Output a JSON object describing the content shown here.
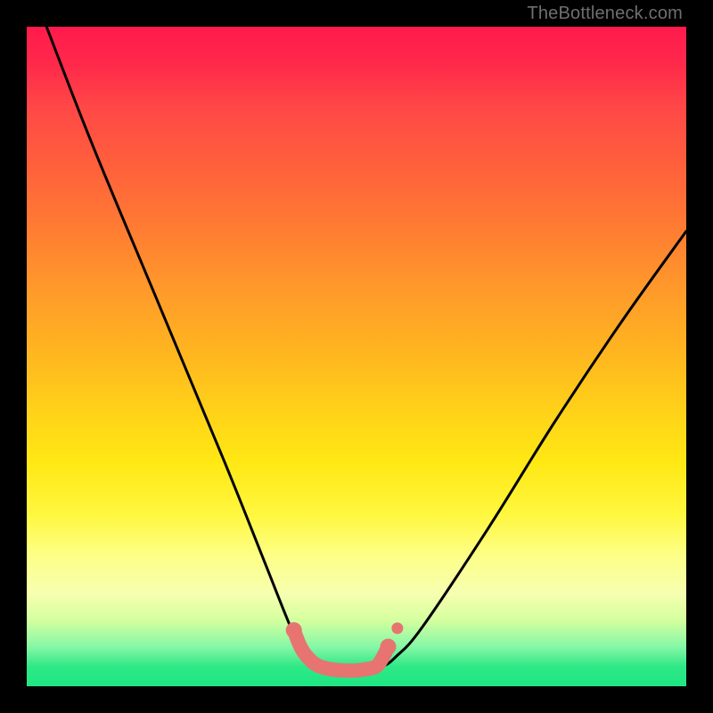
{
  "watermark": "TheBottleneck.com",
  "chart_data": {
    "type": "line",
    "title": "",
    "xlabel": "",
    "ylabel": "",
    "xlim": [
      0,
      100
    ],
    "ylim": [
      0,
      100
    ],
    "series": [
      {
        "name": "curve",
        "x": [
          3,
          10,
          20,
          30,
          36,
          40,
          42,
          44,
          46,
          48,
          50,
          52,
          54,
          56,
          60,
          70,
          80,
          90,
          100
        ],
        "values": [
          100,
          82,
          58,
          34,
          19,
          9,
          5,
          3,
          2.5,
          2.3,
          2.3,
          2.5,
          3,
          4.5,
          9,
          24,
          40,
          55,
          69
        ]
      },
      {
        "name": "highlight",
        "x": [
          40.5,
          41.5,
          42.5,
          44,
          46,
          48,
          50,
          51.5,
          53,
          54,
          54.8
        ],
        "values": [
          8.5,
          6.0,
          4.5,
          3.2,
          2.6,
          2.4,
          2.4,
          2.6,
          3.0,
          4.4,
          6.0
        ]
      }
    ],
    "colors": {
      "curve": "#000000",
      "highlight": "#E77471",
      "highlight_end": "#E77471"
    }
  }
}
